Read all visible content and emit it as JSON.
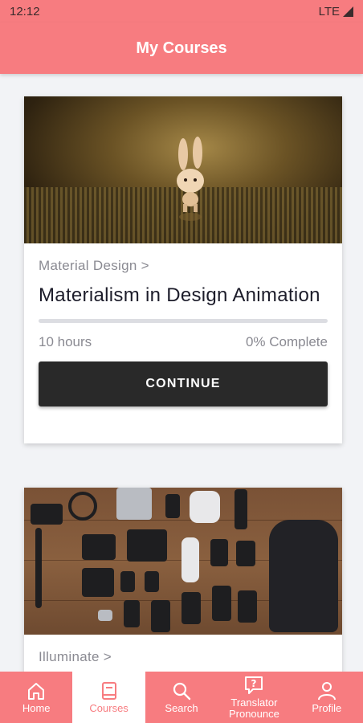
{
  "status_bar": {
    "time": "12:12",
    "network": "LTE"
  },
  "app_bar": {
    "title": "My Courses"
  },
  "colors": {
    "accent": "#f77c80",
    "button": "#292929"
  },
  "courses": [
    {
      "category": "Material Design >",
      "title": "Materialism in Design Animation",
      "hours": "10 hours",
      "progress_label": "0% Complete",
      "progress": 0,
      "button_label": "CONTINUE"
    },
    {
      "category": "Illuminate >"
    }
  ],
  "bottom_nav": [
    {
      "label": "Home",
      "icon": "home-icon"
    },
    {
      "label": "Courses",
      "icon": "book-icon",
      "active": true
    },
    {
      "label": "Search",
      "icon": "search-icon"
    },
    {
      "label": "Translator Pronounce",
      "icon": "question-bubble-icon"
    },
    {
      "label": "Profile",
      "icon": "person-icon"
    }
  ]
}
